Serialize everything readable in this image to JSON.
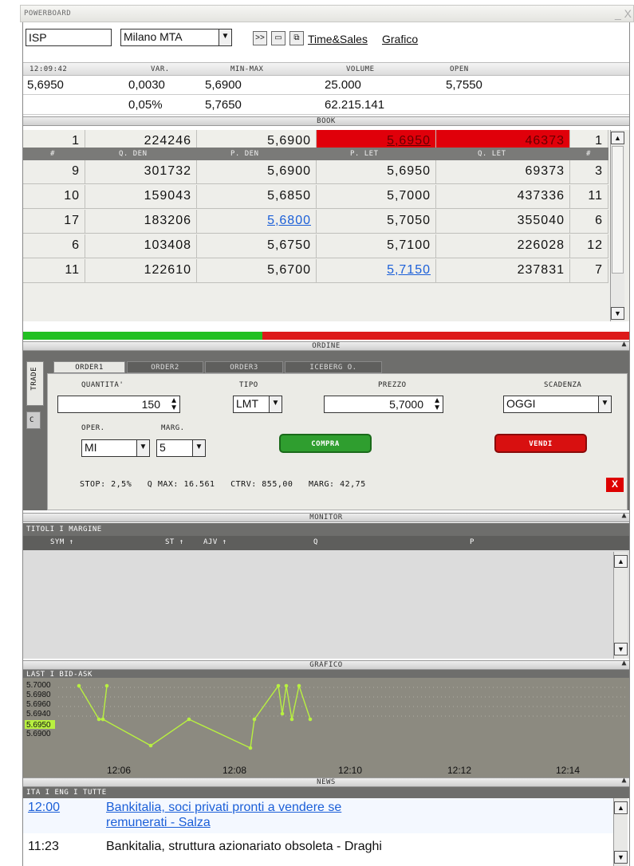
{
  "window": {
    "title": "POWERBOARD",
    "close": "_ X"
  },
  "toolbar": {
    "symbol": "ISP",
    "market": "Milano MTA",
    "time_sales": "Time&Sales",
    "grafico": "Grafico",
    "btn1": ">>",
    "btn2": "▭",
    "btn3": "⧉"
  },
  "quote": {
    "headers": [
      "12:09:42",
      "VAR.",
      "MIN-MAX",
      "VOLUME",
      "OPEN"
    ],
    "row1": [
      "5,6950",
      "0,0030",
      "5,6900",
      "25.000",
      "5,7550"
    ],
    "row2": [
      "",
      "0,05%",
      "5,7650",
      "62.215.141",
      ""
    ]
  },
  "book": {
    "section": "BOOK",
    "top": [
      "1",
      "224246",
      "5,6900",
      "5,6950",
      "46373",
      "1"
    ],
    "headers": [
      "#",
      "Q. DEN",
      "P. DEN",
      "P. LET",
      "Q. LET",
      "#"
    ],
    "rows": [
      [
        "9",
        "301732",
        "5,6900",
        "5,6950",
        "69373",
        "3"
      ],
      [
        "10",
        "159043",
        "5,6850",
        "5,7000",
        "437336",
        "11"
      ],
      [
        "17",
        "183206",
        "5,6800",
        "5,7050",
        "355040",
        "6"
      ],
      [
        "6",
        "103408",
        "5,6750",
        "5,7100",
        "226028",
        "12"
      ],
      [
        "11",
        "122610",
        "5,6700",
        "5,7150",
        "237831",
        "7"
      ]
    ],
    "bid_ratio": 0.395
  },
  "ordine": {
    "section": "ORDINE",
    "side_tabs": [
      "TRADE",
      "C"
    ],
    "tabs": [
      "ORDER1",
      "ORDER2",
      "ORDER3",
      "ICEBERG O."
    ],
    "labels": {
      "qty": "QUANTITA'",
      "tipo": "TIPO",
      "prezzo": "PREZZO",
      "scadenza": "SCADENZA",
      "oper": "OPER.",
      "marg": "MARG."
    },
    "values": {
      "qty": "150",
      "tipo": "LMT",
      "prezzo": "5,7000",
      "scadenza": "OGGI",
      "oper": "MI",
      "marg": "5"
    },
    "buy": "COMPRA",
    "sell": "VENDI",
    "summary": {
      "stop_l": "STOP:",
      "stop": "2,5%",
      "qmax_l": "Q MAX:",
      "qmax": "16.561",
      "ctrv_l": "CTRV:",
      "ctrv": "855,00",
      "marg_l": "MARG:",
      "marg": "42,75"
    },
    "x": "X",
    "colors": {
      "buy": "#2f9e2f",
      "sell": "#d81010"
    }
  },
  "monitor": {
    "section": "MONITOR",
    "tabs": "TITOLI I MARGINE",
    "cols": [
      "SYM ↑",
      "ST ↑",
      "AJV ↑",
      "Q",
      "P"
    ]
  },
  "grafico": {
    "section": "GRAFICO",
    "tabs": "LAST I BID-ASK",
    "ylabels": [
      "5.7000",
      "5.6980",
      "5.6960",
      "5.6940",
      "5.6950",
      "5.6900"
    ],
    "xlabels": [
      "12:06",
      "12:08",
      "12:10",
      "12:12",
      "12:14"
    ]
  },
  "news": {
    "section": "NEWS",
    "tabs": "ITA I ENG I TUTTE",
    "items": [
      {
        "time": "12:00",
        "text1": "Bankitalia, soci privati pronti a vendere se",
        "text2": "remunerati - Salza"
      },
      {
        "time": "11:23",
        "text1": "Bankitalia, struttura azionariato obsoleta - Draghi",
        "text2": ""
      }
    ]
  }
}
